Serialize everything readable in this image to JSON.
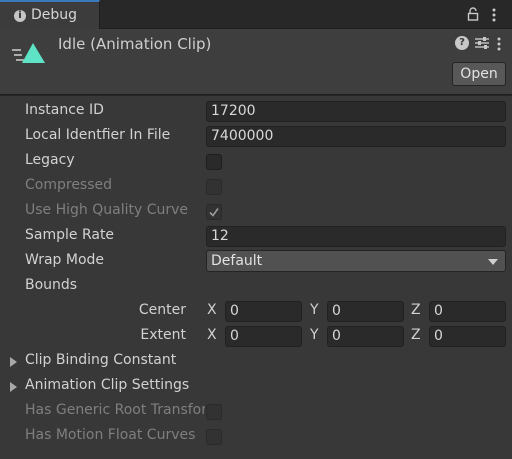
{
  "window": {
    "tab_label": "Debug",
    "tab_icon": "info-icon"
  },
  "header": {
    "title": "Idle (Animation Clip)",
    "open_label": "Open",
    "icon": "animation-clip-icon",
    "accent_color": "#5fe3c7"
  },
  "fields": {
    "instance_id": {
      "label": "Instance ID",
      "value": "17200"
    },
    "local_identifier": {
      "label": "Local Identfier In File",
      "value": "7400000"
    },
    "legacy": {
      "label": "Legacy",
      "checked": false
    },
    "compressed": {
      "label": "Compressed",
      "checked": false
    },
    "high_quality_curve": {
      "label": "Use High Quality Curve",
      "checked": true
    },
    "sample_rate": {
      "label": "Sample Rate",
      "value": "12"
    },
    "wrap_mode": {
      "label": "Wrap Mode",
      "value": "Default"
    },
    "bounds": {
      "label": "Bounds",
      "center": {
        "label": "Center",
        "x_label": "X",
        "x": "0",
        "y_label": "Y",
        "y": "0",
        "z_label": "Z",
        "z": "0"
      },
      "extent": {
        "label": "Extent",
        "x_label": "X",
        "x": "0",
        "y_label": "Y",
        "y": "0",
        "z_label": "Z",
        "z": "0"
      }
    },
    "clip_binding_constant": {
      "label": "Clip Binding Constant"
    },
    "animation_clip_settings": {
      "label": "Animation Clip Settings"
    },
    "has_generic_root_transform": {
      "label": "Has Generic Root Transform",
      "checked": false
    },
    "has_motion_float_curves": {
      "label": "Has Motion Float Curves",
      "checked": false
    }
  }
}
